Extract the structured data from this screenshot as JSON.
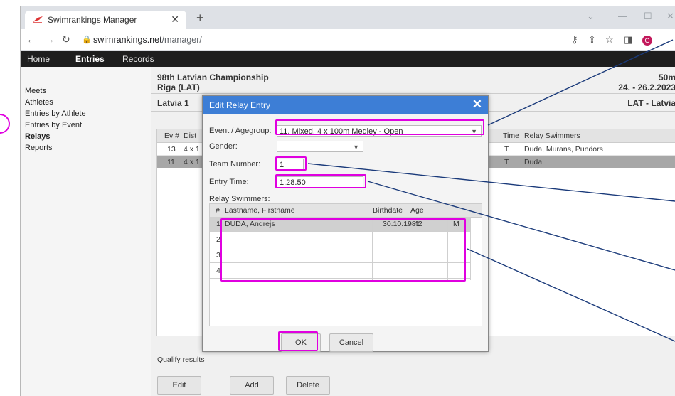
{
  "browser": {
    "tab_title": "Swimrankings Manager",
    "url_domain": "swimrankings.net",
    "url_path": "/manager/",
    "avatar_letter": "G"
  },
  "menu": {
    "items": [
      "Home",
      "Entries",
      "Records"
    ],
    "active": "Entries"
  },
  "sidebar": {
    "items": [
      "Meets",
      "Athletes",
      "Entries by Athlete",
      "Entries by Event",
      "Relays",
      "Reports"
    ],
    "active": "Relays"
  },
  "main": {
    "meet_title": "98th Latvian Championship",
    "meet_location": "Riga (LAT)",
    "course": "50m",
    "dates": "24. - 26.2.2023",
    "club": "Latvia 1",
    "club_code": "LAT - Latvia",
    "columns": {
      "ev": "Ev #",
      "dist": "Dist",
      "time": "Time",
      "swimmers": "Relay Swimmers"
    },
    "rows": [
      {
        "ev": "13",
        "dist": "4 x 1",
        "time": "T",
        "swimmers": "Duda, Murans, Pundors"
      },
      {
        "ev": "11",
        "dist": "4 x 1",
        "time": "T",
        "swimmers": "Duda"
      }
    ],
    "qualify_text": "Qualify results",
    "buttons": {
      "edit": "Edit",
      "add": "Add",
      "delete": "Delete"
    }
  },
  "modal": {
    "title": "Edit Relay Entry",
    "event_label": "Event / Agegroup:",
    "event_value": "11. Mixed, 4 x 100m Medley - Open",
    "gender_label": "Gender:",
    "gender_value": "",
    "team_label": "Team Number:",
    "team_value": "1",
    "time_label": "Entry Time:",
    "time_value": "1:28.50",
    "swimmers_label": "Relay Swimmers:",
    "cols": {
      "num": "#",
      "name": "Lastname, Firstname",
      "birth": "Birthdate",
      "age": "Age"
    },
    "swimmers": [
      {
        "num": "1",
        "name": "DUDA, Andrejs",
        "birth": "30.10.1981",
        "age": "42",
        "gender": "M"
      },
      {
        "num": "2",
        "name": "",
        "birth": "",
        "age": "",
        "gender": ""
      },
      {
        "num": "3",
        "name": "",
        "birth": "",
        "age": "",
        "gender": ""
      },
      {
        "num": "4",
        "name": "",
        "birth": "",
        "age": "",
        "gender": ""
      }
    ],
    "ok": "OK",
    "cancel": "Cancel"
  },
  "colors": {
    "highlight": "#e000e0",
    "arrow": "#1a3a7a",
    "modal_header": "#3d7ed6",
    "menu_bg": "#1e1e1e"
  }
}
